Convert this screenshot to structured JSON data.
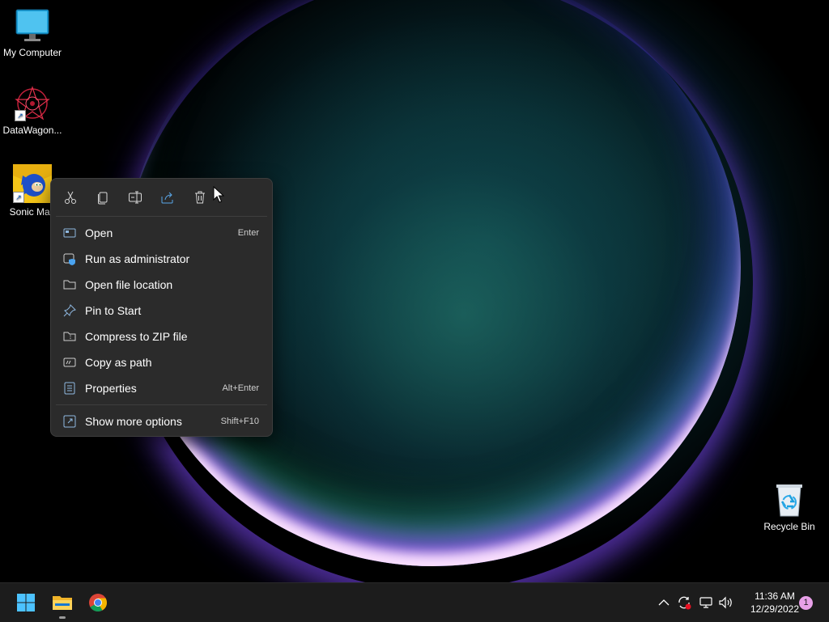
{
  "desktop": {
    "icons": [
      {
        "label": "My Computer",
        "icon": "monitor-icon"
      },
      {
        "label": "DataWagon...",
        "icon": "datawagon-icon"
      },
      {
        "label": "Sonic Man",
        "icon": "sonic-icon"
      },
      {
        "label": "Recycle Bin",
        "icon": "recycle-bin-icon"
      }
    ]
  },
  "context_menu": {
    "quick_actions": [
      {
        "name": "cut",
        "icon": "scissors-icon"
      },
      {
        "name": "copy",
        "icon": "copy-icon"
      },
      {
        "name": "rename",
        "icon": "rename-icon"
      },
      {
        "name": "share",
        "icon": "share-icon"
      },
      {
        "name": "delete",
        "icon": "trash-icon"
      }
    ],
    "items": [
      {
        "label": "Open",
        "shortcut": "Enter",
        "icon": "open-icon"
      },
      {
        "label": "Run as administrator",
        "shortcut": "",
        "icon": "shield-icon"
      },
      {
        "label": "Open file location",
        "shortcut": "",
        "icon": "folder-icon"
      },
      {
        "label": "Pin to Start",
        "shortcut": "",
        "icon": "pin-icon"
      },
      {
        "label": "Compress to ZIP file",
        "shortcut": "",
        "icon": "zip-icon"
      },
      {
        "label": "Copy as path",
        "shortcut": "",
        "icon": "path-icon"
      },
      {
        "label": "Properties",
        "shortcut": "Alt+Enter",
        "icon": "properties-icon"
      },
      {
        "label": "Show more options",
        "shortcut": "Shift+F10",
        "icon": "more-options-icon"
      }
    ]
  },
  "taskbar": {
    "apps": [
      {
        "name": "start",
        "icon": "windows-start-icon"
      },
      {
        "name": "file-explorer",
        "icon": "file-explorer-icon"
      },
      {
        "name": "chrome",
        "icon": "chrome-icon"
      }
    ],
    "tray": {
      "time": "11:36 AM",
      "date": "12/29/2022",
      "notification_count": "1"
    }
  },
  "colors": {
    "menu_bg": "#2b2b2b",
    "taskbar_bg": "#1c1c1c",
    "accent": "#4cc2ff"
  }
}
